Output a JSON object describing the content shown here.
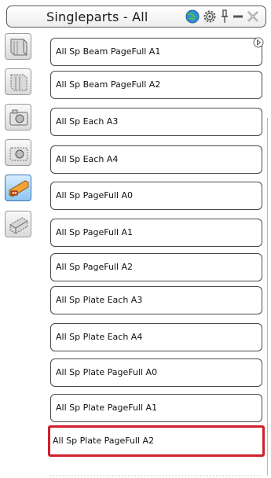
{
  "window": {
    "title": "Singleparts - All"
  },
  "titlebar_icons": [
    {
      "name": "globe-icon"
    },
    {
      "name": "gear-icon"
    },
    {
      "name": "pin-icon"
    },
    {
      "name": "minimize-icon"
    },
    {
      "name": "close-icon"
    }
  ],
  "sidebar_tools": [
    {
      "name": "beam-view-tool"
    },
    {
      "name": "beam-dashed-view-tool"
    },
    {
      "name": "camera-tool"
    },
    {
      "name": "camera-dashed-tool"
    },
    {
      "name": "plate-active-tool",
      "active": true
    },
    {
      "name": "beam-3d-tool"
    }
  ],
  "list": {
    "items": [
      {
        "label": "All Sp Beam PageFull A1"
      },
      {
        "label": "All Sp Beam PageFull A2"
      },
      {
        "label": "All Sp Each A3"
      },
      {
        "label": "All Sp Each A4"
      },
      {
        "label": "All Sp PageFull A0"
      },
      {
        "label": "All Sp PageFull A1"
      },
      {
        "label": "All Sp PageFull A2"
      },
      {
        "label": "All Sp Plate Each A3"
      },
      {
        "label": "All Sp Plate Each A4"
      },
      {
        "label": "All Sp Plate PageFull A0"
      },
      {
        "label": "All Sp Plate PageFull A1"
      },
      {
        "label": "All Sp Plate PageFull A2",
        "selected": true
      }
    ]
  },
  "colors": {
    "selected_border": "#d0202c",
    "active_tool": "#8ec4f2"
  }
}
